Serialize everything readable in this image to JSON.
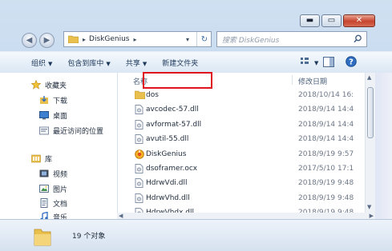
{
  "window": {
    "caption": {
      "minimize_glyph": "▬",
      "maximize_glyph": "▭",
      "close_glyph": "✕"
    }
  },
  "address": {
    "back_glyph": "◀",
    "forward_glyph": "▶",
    "crumb_sep": "▸",
    "crumb": "DiskGenius",
    "crumb_arrow": "▸",
    "dropdown_glyph": "▾",
    "refresh_glyph": "↻",
    "search_placeholder": "搜索 DiskGenius",
    "search_icon": "search-icon"
  },
  "toolbar": {
    "items": [
      "组织",
      "包含到库中",
      "共享",
      "新建文件夹"
    ],
    "dropdown_glyph": "▼"
  },
  "sidebar": {
    "favorites_label": "收藏夹",
    "favorites": [
      "下载",
      "桌面",
      "最近访问的位置"
    ],
    "libraries_label": "库",
    "libraries": [
      "视频",
      "图片",
      "文档",
      "音乐"
    ]
  },
  "list": {
    "col_name": "名称",
    "col_date": "修改日期",
    "rows": [
      {
        "name": "dos",
        "date": "2018/10/14 16:",
        "type": "folder"
      },
      {
        "name": "avcodec-57.dll",
        "date": "2018/9/14 14:4",
        "type": "dll"
      },
      {
        "name": "avformat-57.dll",
        "date": "2018/9/14 14:4",
        "type": "dll"
      },
      {
        "name": "avutil-55.dll",
        "date": "2018/9/14 14:4",
        "type": "dll"
      },
      {
        "name": "DiskGenius",
        "date": "2018/9/19 9:57",
        "type": "app"
      },
      {
        "name": "dsoframer.ocx",
        "date": "2017/5/10 17:1",
        "type": "dll"
      },
      {
        "name": "HdrwVdi.dll",
        "date": "2018/9/19 9:48",
        "type": "dll"
      },
      {
        "name": "HdrwVhd.dll",
        "date": "2018/9/19 9:48",
        "type": "dll"
      },
      {
        "name": "HdrwVhdx.dll",
        "date": "2018/9/19 9:48",
        "type": "dll"
      }
    ]
  },
  "status": {
    "count_text": "19 个对象"
  },
  "colors": {
    "highlight": "#e0141e",
    "folder": "#e9c04d",
    "link": "#1e395b"
  }
}
